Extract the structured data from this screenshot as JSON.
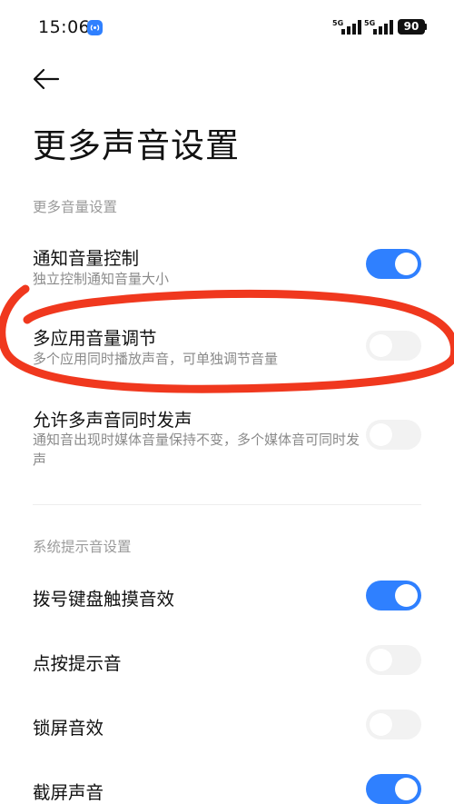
{
  "status_bar": {
    "time": "15:06",
    "network_1": "5G",
    "network_2": "5G",
    "battery": "90"
  },
  "page_title": "更多声音设置",
  "sections": [
    {
      "header": "更多音量设置",
      "items": [
        {
          "title": "通知音量控制",
          "desc": "独立控制通知音量大小",
          "enabled": true
        },
        {
          "title": "多应用音量调节",
          "desc": "多个应用同时播放声音，可单独调节音量",
          "enabled": false
        },
        {
          "title": "允许多声音同时发声",
          "desc": "通知音出现时媒体音量保持不变，多个媒体音可同时发声",
          "enabled": false
        }
      ]
    },
    {
      "header": "系统提示音设置",
      "items": [
        {
          "title": "拨号键盘触摸音效",
          "enabled": true
        },
        {
          "title": "点按提示音",
          "enabled": false
        },
        {
          "title": "锁屏音效",
          "enabled": false
        },
        {
          "title": "截屏声音",
          "enabled": true
        }
      ]
    }
  ],
  "colors": {
    "accent": "#2f80ff",
    "annotation": "#f0381e"
  }
}
